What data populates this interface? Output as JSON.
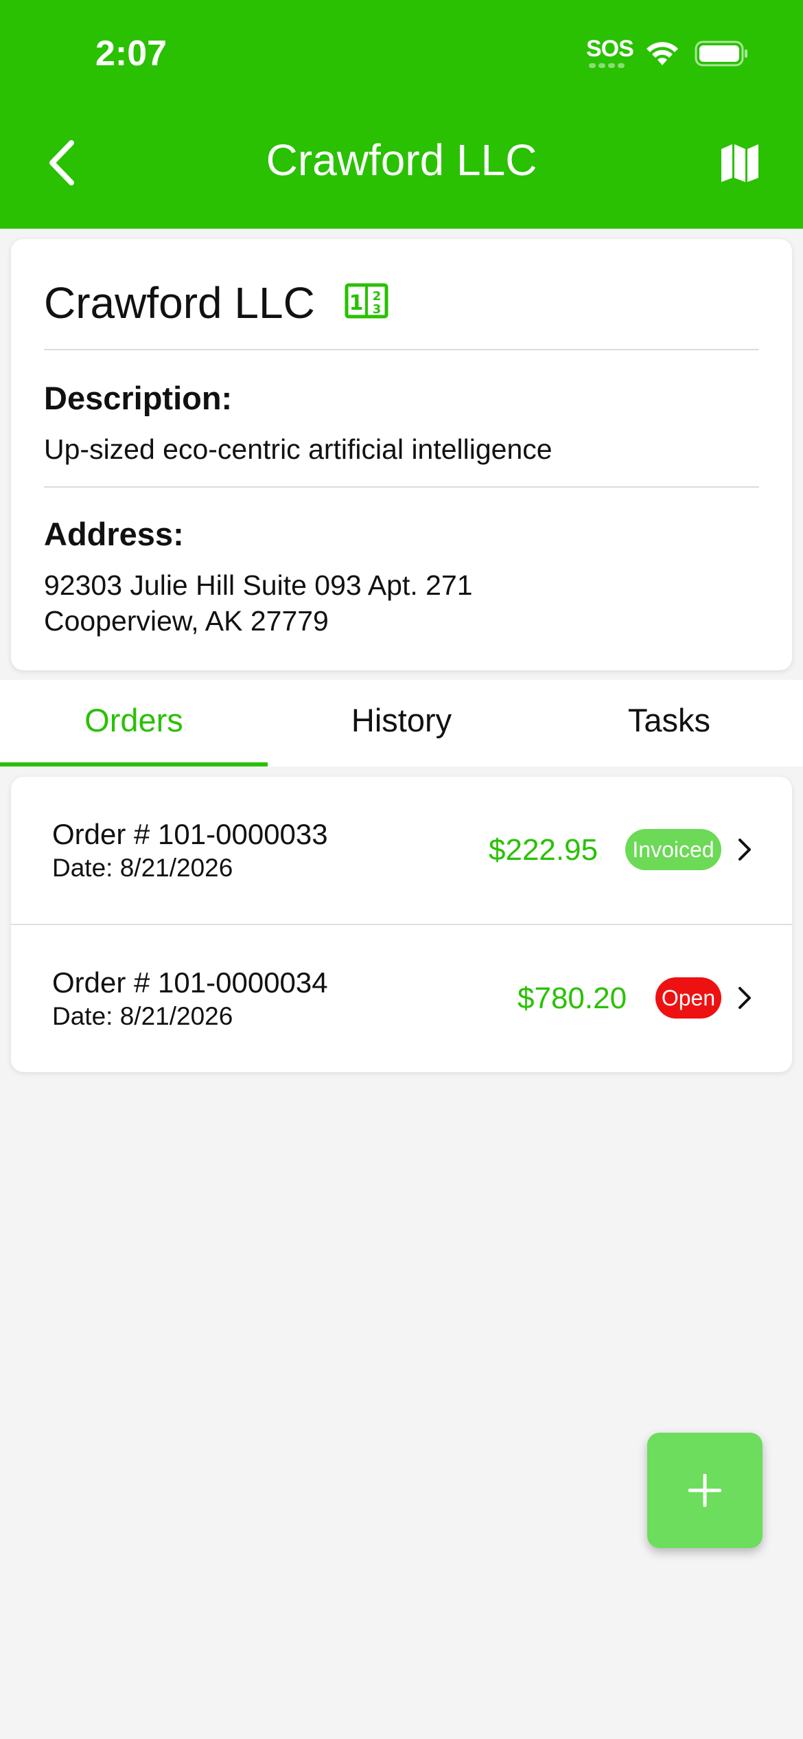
{
  "status_bar": {
    "time": "2:07",
    "sos": "SOS",
    "icons": [
      "wifi-icon",
      "battery-icon"
    ]
  },
  "nav": {
    "title": "Crawford LLC",
    "back_icon": "chevron-left-icon",
    "map_icon": "map-icon"
  },
  "customer": {
    "name": "Crawford LLC",
    "badge_icon": "numbers-grid-icon",
    "description_label": "Description:",
    "description": "Up-sized eco-centric artificial intelligence",
    "address_label": "Address:",
    "address_line1": "92303 Julie Hill Suite 093 Apt. 271",
    "address_line2": "Cooperview, AK 27779"
  },
  "tabs": [
    {
      "label": "Orders",
      "active": true
    },
    {
      "label": "History",
      "active": false
    },
    {
      "label": "Tasks",
      "active": false
    }
  ],
  "orders": [
    {
      "title": "Order # 101-0000033",
      "date": "Date: 8/21/2026",
      "amount": "$222.95",
      "status": "Invoiced",
      "status_color": "#6cd957"
    },
    {
      "title": "Order # 101-0000034",
      "date": "Date: 8/21/2026",
      "amount": "$780.20",
      "status": "Open",
      "status_color": "#ee1111"
    }
  ],
  "colors": {
    "brand": "#29c102",
    "fab": "#6cdd5c",
    "invoiced": "#6cd957",
    "open": "#ee1111"
  },
  "fab": {
    "icon": "plus-icon"
  }
}
